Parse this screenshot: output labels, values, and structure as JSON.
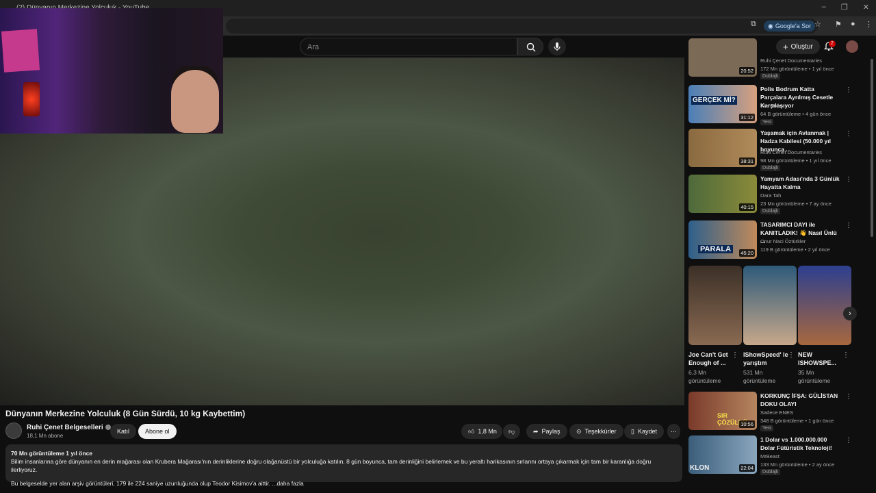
{
  "browser": {
    "tab_title": "(2) Dünyanın Merkezine Yolculuk - YouTube",
    "google_ask": "Google'a Sor"
  },
  "youtube": {
    "search_placeholder": "Ara",
    "create_label": "Oluştur",
    "notif_count": "2"
  },
  "video": {
    "title": "Dünyanın Merkezine Yolculuk (8 Gün Sürdü, 10 kg Kaybettim)",
    "channel": "Ruhi Çenet Belgeselleri",
    "subscribers": "18,1 Mn abone",
    "join_label": "Katıl",
    "subscribe_label": "Abone ol",
    "likes": "1,8 Mn",
    "share_label": "Paylaş",
    "thanks_label": "Teşekkürler",
    "save_label": "Kaydet",
    "views_date": "70 Mn görüntüleme  1 yıl önce",
    "desc_line1": "Bilim insanlarına göre dünyanın en derin mağarası olan Krubera Mağarası'nın derinliklerine doğru olağanüstü bir yolculuğa katılın. 8 gün boyunca, tam derinliğini belirlemek ve bu yeraltı harikasının sırlarını ortaya çıkarmak için tam bir karanlığa doğru ilerliyoruz.",
    "desc_line2": "Bu belgeselde yer alan arşiv görüntüleri, 179 ile 224 saniye uzunluğunda olup Teodor Kisimov'a aittir. ...daha fazla"
  },
  "sidebar": {
    "cards": [
      {
        "title": "",
        "channel": "Ruhi Çenet Documentaries",
        "meta": "172 Mn görüntüleme • 1 yıl önce",
        "tag": "Dublajlı",
        "duration": "20:52",
        "thumb_color": "#7b6a56"
      },
      {
        "title": "Polis Bodrum Katta Parçalara Ayrılmış Cesetle Karşılaşıyor",
        "channel": "The Polis",
        "meta": "64 B görüntüleme • 4 gün önce",
        "tag": "Yeni",
        "duration": "31:12",
        "thumb_color": "#2f5f9a",
        "thumb_text": "GERÇEK Mİ?"
      },
      {
        "title": "Yaşamak için Avlanmak | Hadza Kabilesi (50.000 yıl boyunca ...",
        "channel": "Ruhi Cenet Documentaries",
        "meta": "98 Mn görüntüleme • 1 yıl önce",
        "tag": "Dublajlı",
        "duration": "38:31",
        "thumb_color": "#8a6a40"
      },
      {
        "title": "Yamyam Adası'nda 3 Günlük Hayatta Kalma",
        "channel": "Dara Tah",
        "meta": "23 Mn görüntüleme • 7 ay önce",
        "tag": "Dublajlı",
        "duration": "40:15",
        "thumb_color": "#4d6a3b"
      },
      {
        "title": "TASARIMCI DAYI ile KANITLADIK! 👋 Nasıl Ünlü ...",
        "channel": "Onur Naci Öztürkler",
        "meta": "119 B görüntüleme • 2 yıl önce",
        "tag": "",
        "duration": "45:20",
        "thumb_color": "#2d5f8c",
        "thumb_text": "PARALA"
      },
      {
        "title": "KORKUNÇ İFŞA: GÜLİSTAN DOKU OLAYI",
        "channel": "Sadece ENES",
        "meta": "348 B görüntüleme • 1 gün önce",
        "tag": "Yeni",
        "duration": "10:56",
        "thumb_color": "#7a3a2a",
        "thumb_text": "SIR ÇÖZÜLDÜ"
      },
      {
        "title": "1 Dolar vs 1.000.000.000 Dolar Fütüristik Teknoloji!",
        "channel": "MrBeast",
        "meta": "133 Mn görüntüleme • 2 ay önce",
        "tag": "Dublajlı",
        "duration": "22:04",
        "thumb_color": "#3a5d7a",
        "thumb_text": "KLON"
      }
    ],
    "shorts": [
      {
        "title": "Joe Can't Get Enough of ...",
        "views": "6,3 Mn görüntüleme",
        "color": "#5a4a3e"
      },
      {
        "title": "IShowSpeed' le yarıştım",
        "views": "531 Mn görüntüleme",
        "color": "#3f6f8f"
      },
      {
        "title": "NEW ISHOWSPE...",
        "views": "35 Mn görüntüleme",
        "color": "#6a4a3a"
      }
    ]
  }
}
